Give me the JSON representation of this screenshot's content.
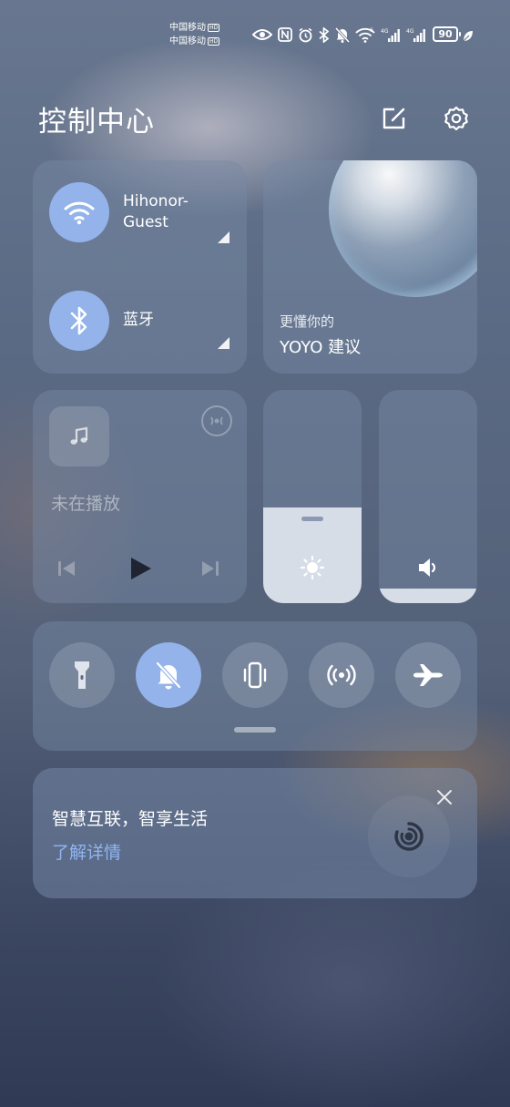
{
  "status_bar": {
    "carrier_1": "中国移动",
    "carrier_2": "中国移动",
    "hd_badge": "HD",
    "net_1": "6",
    "net_2": "4G",
    "net_3": "4G",
    "battery_level": "90"
  },
  "header": {
    "title": "控制中心"
  },
  "connectivity": {
    "wifi_label": "Hihonor-\nGuest",
    "bluetooth_label": "蓝牙"
  },
  "yoyo": {
    "subtitle": "更懂你的",
    "title": "YOYO 建议"
  },
  "media": {
    "status": "未在播放"
  },
  "sliders": {
    "brightness_level": 0.45,
    "volume_level": 0.07
  },
  "toggles": [
    {
      "name": "flashlight",
      "active": false
    },
    {
      "name": "mute",
      "active": true
    },
    {
      "name": "vibrate",
      "active": false
    },
    {
      "name": "hotspot",
      "active": false
    },
    {
      "name": "airplane",
      "active": false
    }
  ],
  "promo": {
    "title": "智慧互联，智享生活",
    "link": "了解详情"
  },
  "colors": {
    "accent": "#93b3ea",
    "link": "#8fb5f2"
  }
}
